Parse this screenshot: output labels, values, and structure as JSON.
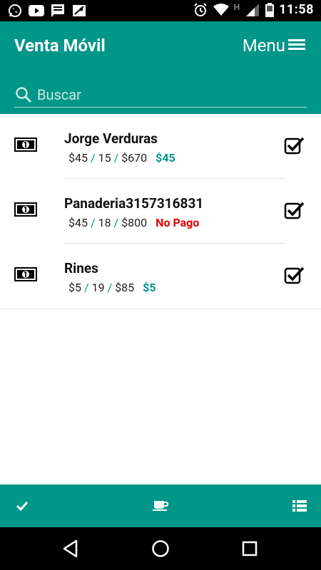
{
  "status_bar": {
    "time": "11:58",
    "left_icons": [
      "whatsapp-icon",
      "youtube-icon",
      "message-icon",
      "map-icon"
    ],
    "right_icons": [
      "alarm-icon",
      "wifi-icon",
      "h-signal-icon",
      "signal-icon",
      "battery-icon"
    ],
    "network_letter": "H"
  },
  "app_bar": {
    "title": "Venta Móvil",
    "menu_label": "Menu",
    "search_placeholder": "Buscar",
    "background_color": "#009688"
  },
  "sales": [
    {
      "name": "Jorge Verduras",
      "price": "$45",
      "quantity": "15",
      "total": "$670",
      "amount": "$45",
      "status": "paid",
      "checked": true
    },
    {
      "name": "Panaderia3157316831",
      "price": "$45",
      "quantity": "18",
      "total": "$800",
      "amount": "No Pago",
      "status": "unpaid",
      "checked": true
    },
    {
      "name": "Rines",
      "price": "$5",
      "quantity": "19",
      "total": "$85",
      "amount": "$5",
      "status": "paid",
      "checked": true
    }
  ],
  "separator": "/",
  "colors": {
    "accent": "#009688",
    "unpaid": "#e60000"
  },
  "bottom_bar": {
    "icons": [
      "check-icon",
      "coffee-cup-icon",
      "list-icon"
    ]
  },
  "nav_bar": {
    "icons": [
      "back-icon",
      "home-icon",
      "recents-icon"
    ]
  }
}
